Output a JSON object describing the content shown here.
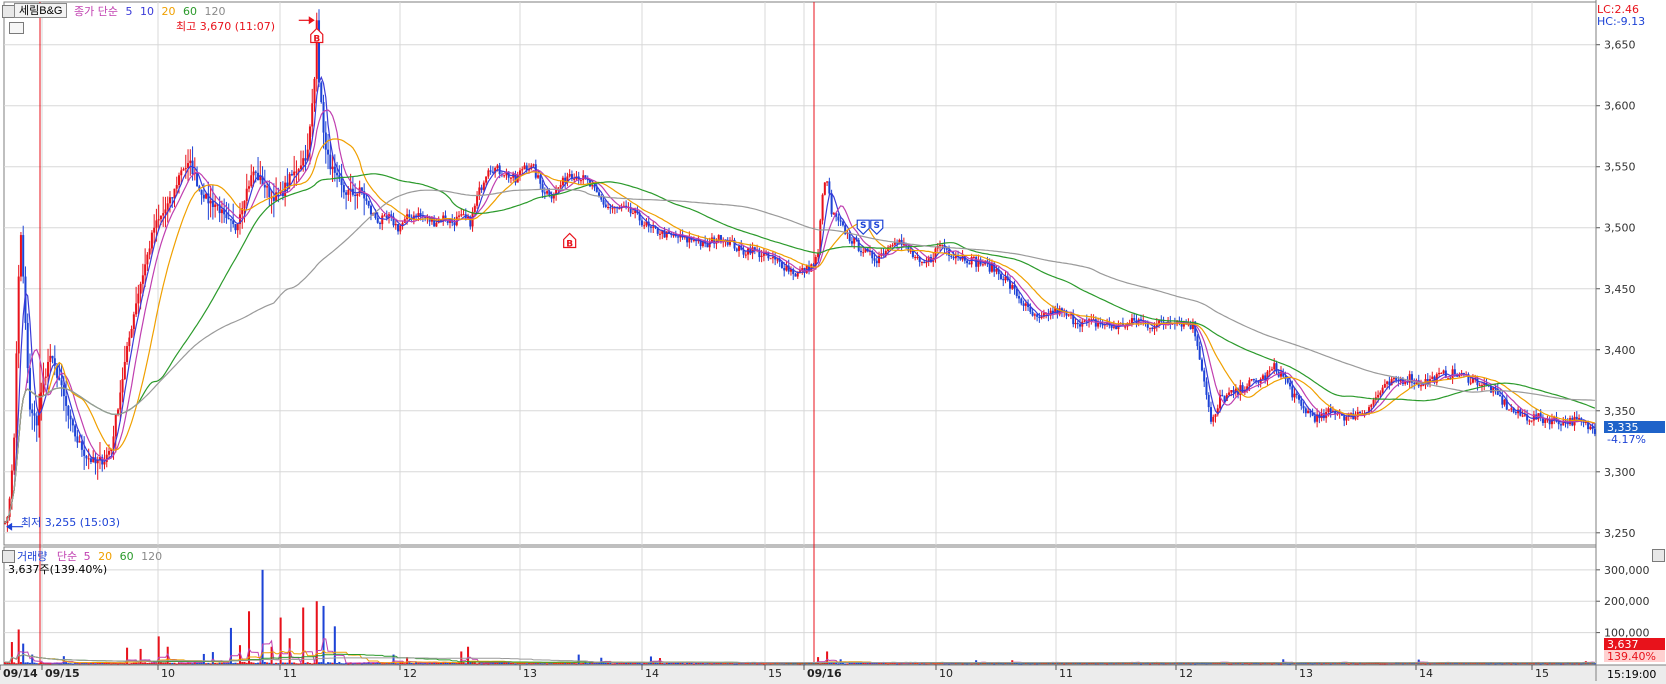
{
  "header": {
    "stock_name": "세림B&G",
    "price_indicator": "종가 단순",
    "ma_periods": [
      "5",
      "10",
      "20",
      "60",
      "120"
    ],
    "lc_label": "LC:2.46",
    "hc_label": "HC:-9.13",
    "volume_indicator_name": "거래량",
    "volume_ma_type": "단순",
    "volume_ma_periods": [
      "5",
      "20",
      "60",
      "120"
    ],
    "volume_readout": "3,637주(139.40%)"
  },
  "colors": {
    "up": "#e8121b",
    "down": "#1d43d6",
    "ma5": "#3a3ad8",
    "ma10": "#c03fb0",
    "ma20": "#f0a000",
    "ma60": "#2b9a2b",
    "ma120": "#9a9a9a",
    "grid": "#d8d8d8",
    "current_price_box": "#1f63c9",
    "current_volume_box": "#e8121b"
  },
  "price_labels": {
    "high": "최고 3,670 (11:07)",
    "low": "최저 3,255 (15:03)",
    "current_price": "3,335",
    "current_change": "-4.17%"
  },
  "volume_labels": {
    "current_volume": "3,637",
    "current_ratio": "139.40%"
  },
  "axis": {
    "time_label": "15:19:00"
  },
  "chart_data": {
    "type": "candlestick",
    "price_axis": {
      "ticks": [
        3250,
        3300,
        3350,
        3400,
        3450,
        3500,
        3550,
        3600,
        3650
      ],
      "tick_labels": [
        "3,250",
        "3,300",
        "3,350",
        "3,400",
        "3,450",
        "3,500",
        "3,550",
        "3,600",
        "3,650"
      ],
      "range": [
        3240,
        3685
      ]
    },
    "volume_axis": {
      "ticks": [
        100000,
        200000,
        300000
      ],
      "tick_labels": [
        "100,000",
        "200,000",
        "300,000"
      ],
      "range": [
        0,
        360000
      ]
    },
    "x_labels": [
      {
        "label": "09/14",
        "date_marker": true
      },
      {
        "label": "09/15",
        "date_marker": true
      },
      {
        "label": "10"
      },
      {
        "label": "11"
      },
      {
        "label": "12"
      },
      {
        "label": "13"
      },
      {
        "label": "14"
      },
      {
        "label": "15"
      },
      {
        "label": "09/16",
        "date_marker": true
      },
      {
        "label": "10"
      },
      {
        "label": "11"
      },
      {
        "label": "12"
      },
      {
        "label": "13"
      },
      {
        "label": "14"
      },
      {
        "label": "15"
      }
    ],
    "price_path": [
      [
        0,
        3258
      ],
      [
        2,
        3275
      ],
      [
        4,
        3330
      ],
      [
        6,
        3460
      ],
      [
        7,
        3495
      ],
      [
        9,
        3420
      ],
      [
        11,
        3350
      ],
      [
        14,
        3340
      ],
      [
        17,
        3375
      ],
      [
        20,
        3395
      ],
      [
        24,
        3375
      ],
      [
        28,
        3345
      ],
      [
        32,
        3325
      ],
      [
        36,
        3313
      ],
      [
        40,
        3307
      ],
      [
        44,
        3310
      ],
      [
        47,
        3320
      ],
      [
        50,
        3355
      ],
      [
        54,
        3400
      ],
      [
        58,
        3440
      ],
      [
        62,
        3470
      ],
      [
        66,
        3500
      ],
      [
        70,
        3512
      ],
      [
        74,
        3525
      ],
      [
        78,
        3548
      ],
      [
        82,
        3552
      ],
      [
        86,
        3532
      ],
      [
        90,
        3522
      ],
      [
        94,
        3518
      ],
      [
        98,
        3505
      ],
      [
        102,
        3500
      ],
      [
        106,
        3526
      ],
      [
        110,
        3546
      ],
      [
        114,
        3537
      ],
      [
        118,
        3525
      ],
      [
        122,
        3527
      ],
      [
        126,
        3540
      ],
      [
        130,
        3550
      ],
      [
        134,
        3562
      ],
      [
        136,
        3600
      ],
      [
        138,
        3645
      ],
      [
        140,
        3600
      ],
      [
        142,
        3562
      ],
      [
        146,
        3542
      ],
      [
        150,
        3530
      ],
      [
        154,
        3528
      ],
      [
        158,
        3530
      ],
      [
        162,
        3512
      ],
      [
        166,
        3505
      ],
      [
        170,
        3508
      ],
      [
        174,
        3500
      ],
      [
        178,
        3507
      ],
      [
        182,
        3512
      ],
      [
        186,
        3508
      ],
      [
        190,
        3505
      ],
      [
        194,
        3508
      ],
      [
        198,
        3505
      ],
      [
        202,
        3508
      ],
      [
        206,
        3505
      ],
      [
        210,
        3530
      ],
      [
        214,
        3550
      ],
      [
        218,
        3547
      ],
      [
        222,
        3545
      ],
      [
        226,
        3538
      ],
      [
        230,
        3552
      ],
      [
        234,
        3548
      ],
      [
        238,
        3532
      ],
      [
        242,
        3527
      ],
      [
        246,
        3535
      ],
      [
        250,
        3545
      ],
      [
        254,
        3542
      ],
      [
        258,
        3537
      ],
      [
        262,
        3527
      ],
      [
        266,
        3518
      ],
      [
        270,
        3515
      ],
      [
        274,
        3515
      ],
      [
        278,
        3512
      ],
      [
        282,
        3505
      ],
      [
        286,
        3498
      ],
      [
        290,
        3497
      ],
      [
        294,
        3493
      ],
      [
        298,
        3492
      ],
      [
        302,
        3490
      ],
      [
        306,
        3491
      ],
      [
        310,
        3484
      ],
      [
        314,
        3490
      ],
      [
        318,
        3492
      ],
      [
        322,
        3487
      ],
      [
        326,
        3480
      ],
      [
        330,
        3483
      ],
      [
        334,
        3479
      ],
      [
        338,
        3475
      ],
      [
        342,
        3472
      ],
      [
        346,
        3468
      ],
      [
        350,
        3462
      ],
      [
        354,
        3465
      ],
      [
        358,
        3470
      ],
      [
        360,
        3478
      ],
      [
        362,
        3530
      ],
      [
        364,
        3538
      ],
      [
        366,
        3512
      ],
      [
        370,
        3502
      ],
      [
        374,
        3492
      ],
      [
        378,
        3485
      ],
      [
        382,
        3478
      ],
      [
        386,
        3475
      ],
      [
        390,
        3482
      ],
      [
        394,
        3492
      ],
      [
        398,
        3485
      ],
      [
        402,
        3477
      ],
      [
        406,
        3468
      ],
      [
        410,
        3475
      ],
      [
        414,
        3487
      ],
      [
        418,
        3480
      ],
      [
        422,
        3477
      ],
      [
        426,
        3475
      ],
      [
        430,
        3472
      ],
      [
        434,
        3470
      ],
      [
        438,
        3466
      ],
      [
        442,
        3460
      ],
      [
        446,
        3450
      ],
      [
        450,
        3440
      ],
      [
        454,
        3430
      ],
      [
        458,
        3423
      ],
      [
        462,
        3430
      ],
      [
        466,
        3432
      ],
      [
        470,
        3428
      ],
      [
        474,
        3424
      ],
      [
        478,
        3422
      ],
      [
        482,
        3422
      ],
      [
        486,
        3421
      ],
      [
        490,
        3419
      ],
      [
        494,
        3420
      ],
      [
        498,
        3422
      ],
      [
        502,
        3424
      ],
      [
        506,
        3421
      ],
      [
        510,
        3420
      ],
      [
        514,
        3423
      ],
      [
        518,
        3425
      ],
      [
        522,
        3422
      ],
      [
        526,
        3420
      ],
      [
        528,
        3405
      ],
      [
        530,
        3385
      ],
      [
        532,
        3365
      ],
      [
        534,
        3340
      ],
      [
        536,
        3345
      ],
      [
        538,
        3360
      ],
      [
        542,
        3363
      ],
      [
        546,
        3365
      ],
      [
        550,
        3372
      ],
      [
        554,
        3374
      ],
      [
        558,
        3378
      ],
      [
        562,
        3385
      ],
      [
        566,
        3378
      ],
      [
        570,
        3365
      ],
      [
        574,
        3353
      ],
      [
        578,
        3347
      ],
      [
        582,
        3343
      ],
      [
        586,
        3348
      ],
      [
        590,
        3350
      ],
      [
        594,
        3344
      ],
      [
        598,
        3347
      ],
      [
        602,
        3350
      ],
      [
        606,
        3358
      ],
      [
        610,
        3368
      ],
      [
        614,
        3373
      ],
      [
        618,
        3375
      ],
      [
        622,
        3377
      ],
      [
        626,
        3372
      ],
      [
        630,
        3375
      ],
      [
        634,
        3377
      ],
      [
        638,
        3380
      ],
      [
        642,
        3380
      ],
      [
        646,
        3378
      ],
      [
        650,
        3376
      ],
      [
        654,
        3372
      ],
      [
        658,
        3368
      ],
      [
        662,
        3360
      ],
      [
        666,
        3352
      ],
      [
        670,
        3347
      ],
      [
        674,
        3345
      ],
      [
        678,
        3344
      ],
      [
        682,
        3343
      ],
      [
        686,
        3342
      ],
      [
        690,
        3341
      ],
      [
        694,
        3342
      ],
      [
        698,
        3340
      ],
      [
        702,
        3336
      ],
      [
        704,
        3335
      ]
    ],
    "volume_spikes": [
      [
        3,
        70000
      ],
      [
        6,
        110000
      ],
      [
        8,
        65000
      ],
      [
        12,
        30000
      ],
      [
        26,
        25000
      ],
      [
        54,
        52000
      ],
      [
        60,
        48000
      ],
      [
        68,
        88000
      ],
      [
        72,
        55000
      ],
      [
        88,
        32000
      ],
      [
        92,
        38000
      ],
      [
        100,
        115000
      ],
      [
        104,
        60000
      ],
      [
        108,
        168000
      ],
      [
        114,
        300000
      ],
      [
        118,
        55000
      ],
      [
        122,
        148000
      ],
      [
        126,
        82000
      ],
      [
        132,
        180000
      ],
      [
        138,
        200000
      ],
      [
        141,
        185000
      ],
      [
        146,
        120000
      ],
      [
        172,
        30000
      ],
      [
        178,
        22000
      ],
      [
        202,
        40000
      ],
      [
        205,
        55000
      ],
      [
        254,
        30000
      ],
      [
        264,
        20000
      ],
      [
        286,
        24000
      ],
      [
        290,
        19000
      ],
      [
        360,
        22000
      ],
      [
        364,
        40000
      ],
      [
        370,
        15000
      ],
      [
        430,
        12000
      ],
      [
        446,
        12000
      ],
      [
        566,
        15000
      ],
      [
        626,
        14000
      ],
      [
        700,
        9000
      ]
    ],
    "signals": [
      {
        "label": "B",
        "at": 138,
        "price": 3660
      },
      {
        "label": "B",
        "at": 250,
        "price": 3492
      },
      {
        "label": "S",
        "at": 380,
        "price": 3498
      },
      {
        "label": "S",
        "at": 386,
        "price": 3498
      }
    ],
    "session_markers": [
      0.12,
      0.5
    ],
    "high_index": 138,
    "low_index": 0
  }
}
